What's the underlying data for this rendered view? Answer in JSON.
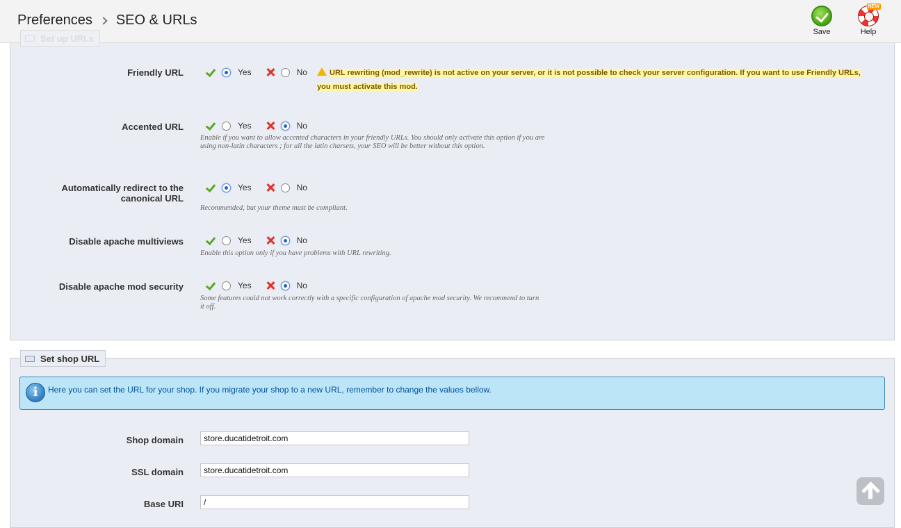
{
  "breadcrumb": {
    "parent": "Preferences",
    "current": "SEO & URLs"
  },
  "toolbar": {
    "save_label": "Save",
    "help_label": "Help",
    "help_badge": "NEW"
  },
  "section1": {
    "legend": "Set up URLs",
    "warning": "URL rewriting (mod_rewrite) is not active on your server, or it is not possible to check your server configuration. If you want to use Friendly URLs, you must activate this mod.",
    "options": [
      {
        "label": "Friendly URL",
        "yes": "Yes",
        "no": "No",
        "selected": "yes",
        "hint": ""
      },
      {
        "label": "Accented URL",
        "yes": "Yes",
        "no": "No",
        "selected": "no",
        "hint": "Enable if you want to allow accented characters in your friendly URLs. You should only activate this option if you are using non-latin characters ; for all the latin charsets, your SEO will be better without this option."
      },
      {
        "label": "Automatically redirect to the canonical URL",
        "yes": "Yes",
        "no": "No",
        "selected": "yes",
        "hint": "Recommended, but your theme must be compliant."
      },
      {
        "label": "Disable apache multiviews",
        "yes": "Yes",
        "no": "No",
        "selected": "no",
        "hint": "Enable this option only if you have problems with URL rewriting."
      },
      {
        "label": "Disable apache mod security",
        "yes": "Yes",
        "no": "No",
        "selected": "no",
        "hint": "Some features could not work correctly with a specific configuration of apache mod security. We recommend to turn it off."
      }
    ]
  },
  "section2": {
    "legend": "Set shop URL",
    "info": "Here you can set the URL for your shop. If you migrate your shop to a new URL, remember to change the values bellow.",
    "fields": [
      {
        "label": "Shop domain",
        "value": "store.ducatidetroit.com"
      },
      {
        "label": "SSL domain",
        "value": "store.ducatidetroit.com"
      },
      {
        "label": "Base URI",
        "value": "/"
      }
    ]
  },
  "colors": {
    "panel_bg": "#ebedf4",
    "info_bg": "#bde5f8",
    "warning_bg": "#fff6a8",
    "check": "#5aa81f",
    "cross": "#e0322c"
  }
}
